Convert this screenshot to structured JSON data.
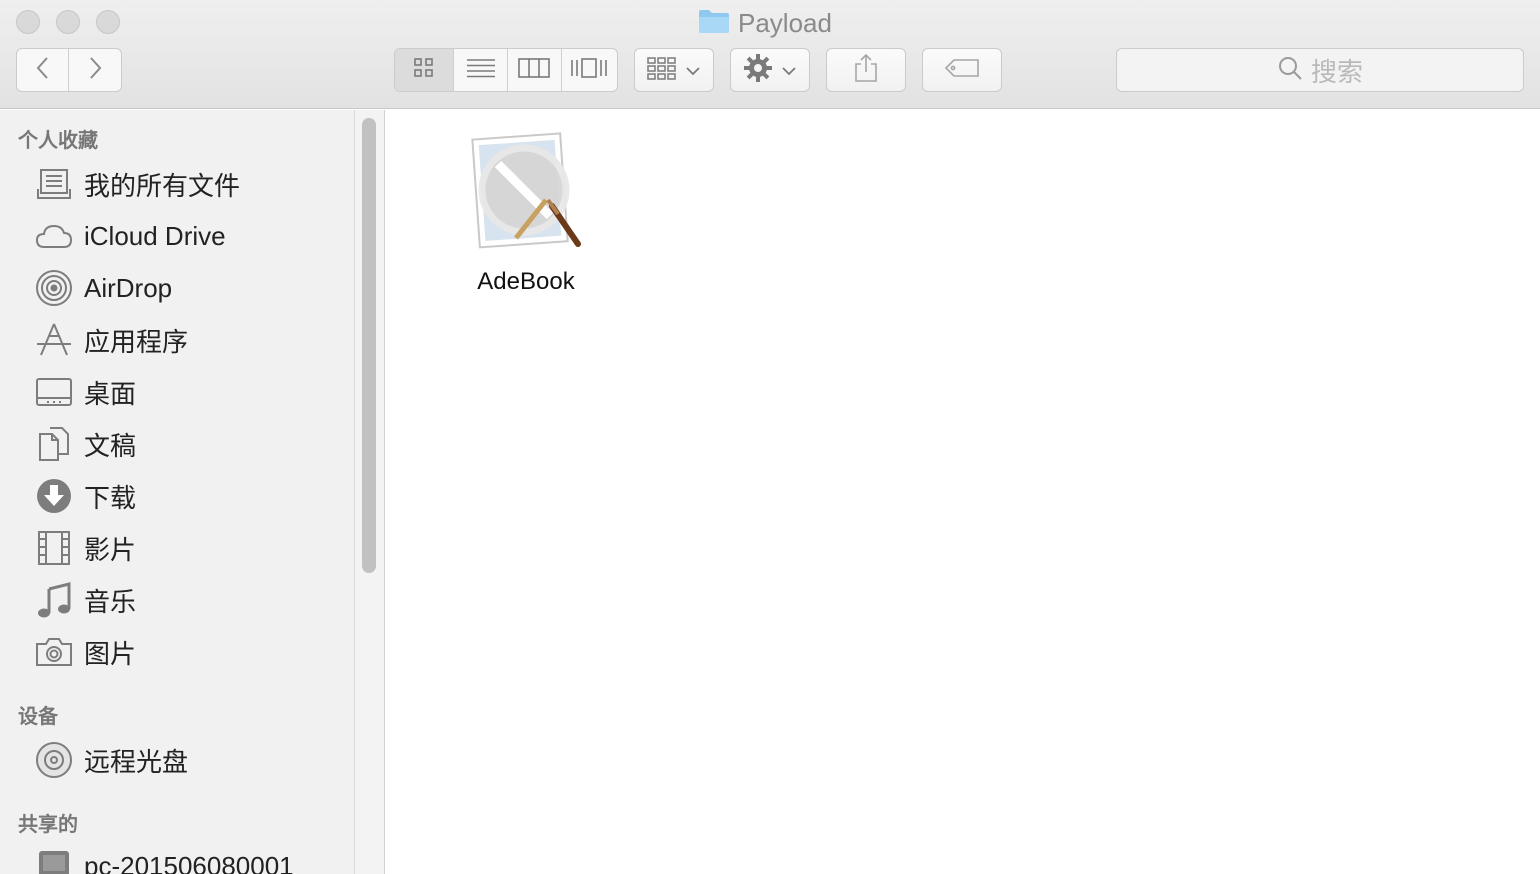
{
  "window": {
    "title": "Payload",
    "title_icon": "folder-icon"
  },
  "toolbar": {
    "back_icon": "chevron-left-icon",
    "forward_icon": "chevron-right-icon",
    "view_modes": [
      "icon-view-icon",
      "list-view-icon",
      "column-view-icon",
      "cover-flow-icon"
    ],
    "active_view": "icon-view-icon",
    "arrange_icon": "arrange-grid-icon",
    "action_icon": "gear-icon",
    "share_icon": "share-icon",
    "tag_icon": "tag-icon",
    "search_placeholder": "搜索"
  },
  "sidebar": {
    "sections": [
      {
        "title": "个人收藏",
        "items": [
          {
            "label": "我的所有文件",
            "icon": "all-files-icon"
          },
          {
            "label": "iCloud Drive",
            "icon": "cloud-icon"
          },
          {
            "label": "AirDrop",
            "icon": "airdrop-icon"
          },
          {
            "label": "应用程序",
            "icon": "applications-icon"
          },
          {
            "label": "桌面",
            "icon": "desktop-icon"
          },
          {
            "label": "文稿",
            "icon": "documents-icon"
          },
          {
            "label": "下载",
            "icon": "download-icon"
          },
          {
            "label": "影片",
            "icon": "movies-icon"
          },
          {
            "label": "音乐",
            "icon": "music-icon"
          },
          {
            "label": "图片",
            "icon": "camera-icon"
          }
        ]
      },
      {
        "title": "设备",
        "items": [
          {
            "label": "远程光盘",
            "icon": "disc-icon"
          }
        ]
      },
      {
        "title": "共享的",
        "items": [
          {
            "label": "pc-201506080001",
            "icon": "computer-icon"
          }
        ]
      }
    ]
  },
  "content": {
    "files": [
      {
        "name": "AdeBook",
        "icon": "prohibited-app-icon"
      }
    ]
  }
}
